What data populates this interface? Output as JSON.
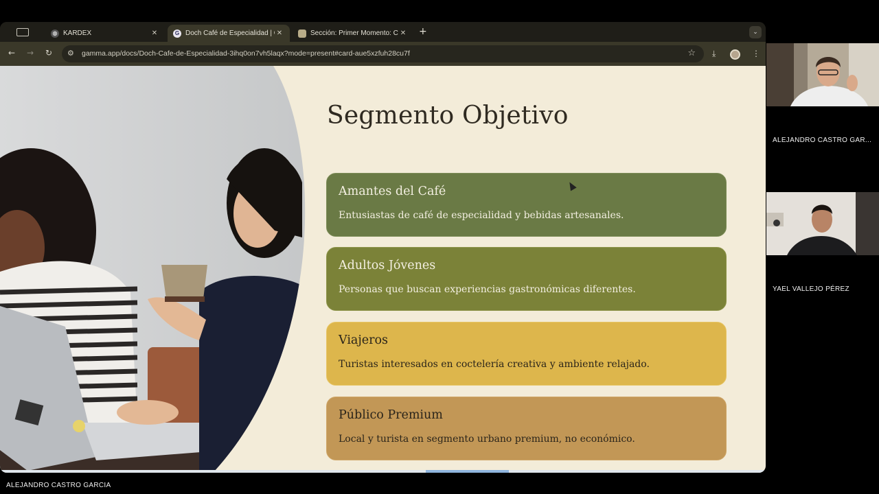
{
  "browser": {
    "tabs": [
      {
        "title": "KARDEX",
        "favicon": "globe-icon",
        "active": false
      },
      {
        "title": "Doch Café de Especialidad | G",
        "favicon": "gamma-icon",
        "active": true
      },
      {
        "title": "Sección: Primer Momento: Co",
        "favicon": "shield-icon",
        "active": false
      }
    ],
    "url": "gamma.app/docs/Doch-Cafe-de-Especialidad-3ihq0on7vh5laqx?mode=present#card-aue5xzfuh28cu7f"
  },
  "slide": {
    "title": "Segmento Objetivo",
    "cards": [
      {
        "title": "Amantes del Café",
        "desc": "Entusiastas de café de especialidad y bebidas artesanales.",
        "color": "#6a7a45"
      },
      {
        "title": "Adultos Jóvenes",
        "desc": "Personas que buscan experiencias gastronómicas diferentes.",
        "color": "#7b8238"
      },
      {
        "title": "Viajeros",
        "desc": "Turistas interesados en coctelería creativa y ambiente relajado.",
        "color": "#ddb64c"
      },
      {
        "title": "Público Premium",
        "desc": "Local y turista en segmento urbano premium, no económico.",
        "color": "#c29756"
      }
    ]
  },
  "participants": [
    {
      "name": "ALEJANDRO CASTRO GAR..."
    },
    {
      "name": "YAEL VALLEJO PÉREZ"
    }
  ],
  "presenter": {
    "name": "ALEJANDRO CASTRO GARCIA"
  }
}
